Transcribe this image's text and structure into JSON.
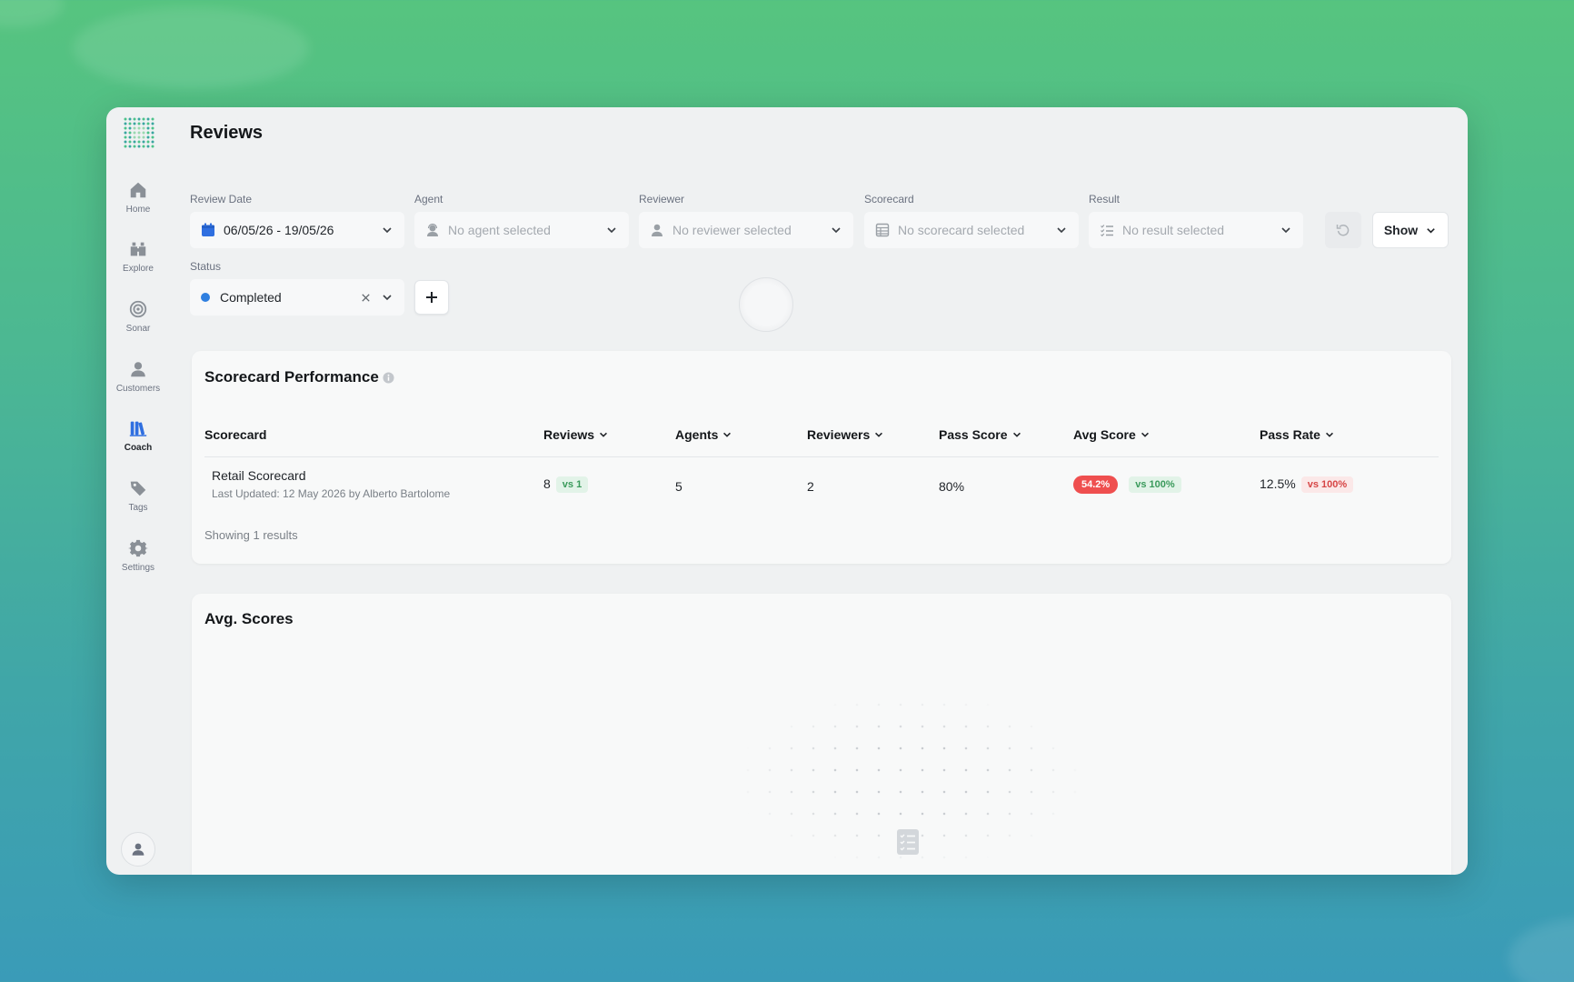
{
  "app": {
    "page_title": "Reviews"
  },
  "sidebar": {
    "items": [
      {
        "label": "Home",
        "icon": "home-icon"
      },
      {
        "label": "Explore",
        "icon": "binoculars-icon"
      },
      {
        "label": "Sonar",
        "icon": "target-icon"
      },
      {
        "label": "Customers",
        "icon": "user-icon"
      },
      {
        "label": "Coach",
        "icon": "books-icon",
        "active": true
      },
      {
        "label": "Tags",
        "icon": "tag-icon"
      },
      {
        "label": "Settings",
        "icon": "gear-icon"
      }
    ],
    "active_color": "#2f6fe0"
  },
  "filters": {
    "review_date": {
      "label": "Review Date",
      "value": "06/05/26 - 19/05/26"
    },
    "agent": {
      "label": "Agent",
      "placeholder": "No agent selected"
    },
    "reviewer": {
      "label": "Reviewer",
      "placeholder": "No reviewer selected"
    },
    "scorecard": {
      "label": "Scorecard",
      "placeholder": "No scorecard selected"
    },
    "result": {
      "label": "Result",
      "placeholder": "No result selected"
    },
    "status": {
      "label": "Status",
      "value": "Completed",
      "dot_color": "#2f7fe0"
    },
    "show_label": "Show"
  },
  "scorecard_performance": {
    "title": "Scorecard Performance",
    "columns": [
      "Scorecard",
      "Reviews",
      "Agents",
      "Reviewers",
      "Pass Score",
      "Avg Score",
      "Pass Rate"
    ],
    "rows": [
      {
        "name": "Retail Scorecard",
        "updated": "Last Updated: 12 May 2026 by Alberto Bartolome",
        "reviews": "8",
        "reviews_vs": "vs 1",
        "agents": "5",
        "reviewers": "2",
        "pass_score": "80%",
        "avg_score": "54.2%",
        "avg_score_vs": "vs 100%",
        "pass_rate": "12.5%",
        "pass_rate_vs": "vs 100%"
      }
    ],
    "footer": "Showing 1 results"
  },
  "avg_scores": {
    "title": "Avg. Scores"
  },
  "colors": {
    "accent_blue": "#2f6fe0",
    "negative_red": "#ef4f4f",
    "positive_green": "#3a9a5b"
  }
}
